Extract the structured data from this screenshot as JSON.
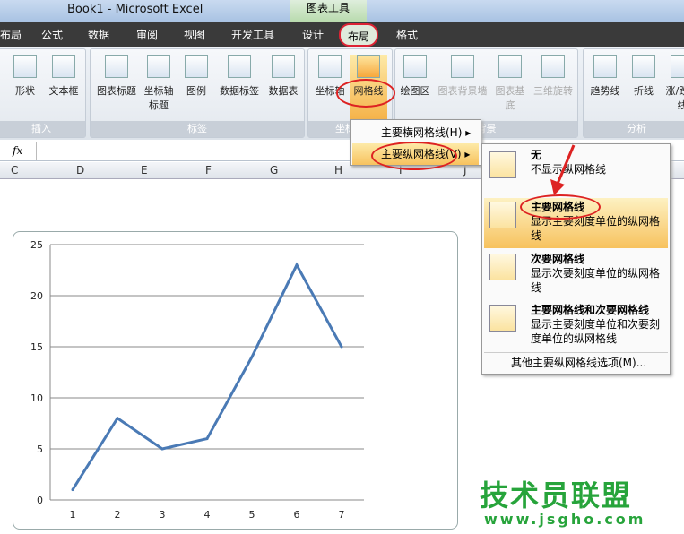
{
  "window": {
    "title": "Book1 - Microsoft Excel",
    "context_tab": "图表工具"
  },
  "tabs": [
    "布局",
    "公式",
    "数据",
    "审阅",
    "视图",
    "开发工具",
    "设计",
    "布局",
    "格式"
  ],
  "ribbon": {
    "insert": {
      "label": "插入",
      "buttons": [
        "形状",
        "文本框"
      ]
    },
    "labels": {
      "label": "标签",
      "buttons": [
        "图表标题",
        "坐标轴标题",
        "图例",
        "数据标签",
        "数据表"
      ]
    },
    "axes": {
      "label": "坐标轴",
      "buttons": [
        "坐标轴",
        "网格线"
      ]
    },
    "background": {
      "label": "背景",
      "buttons": [
        "绘图区",
        "图表背景墙",
        "图表基底",
        "三维旋转"
      ]
    },
    "analysis": {
      "label": "分析",
      "buttons": [
        "趋势线",
        "折线",
        "涨/跌柱线"
      ]
    }
  },
  "formula_bar": {
    "fx": "fx",
    "value": ""
  },
  "columns": [
    "C",
    "D",
    "E",
    "F",
    "G",
    "H",
    "I",
    "J"
  ],
  "gridlines_menu": {
    "items": [
      "主要横网格线(H)",
      "主要纵网格线(V)"
    ]
  },
  "vertical_submenu": {
    "items": [
      {
        "title": "无",
        "desc": "不显示纵网格线"
      },
      {
        "title": "主要网格线",
        "desc": "显示主要刻度单位的纵网格线"
      },
      {
        "title": "次要网格线",
        "desc": "显示次要刻度单位的纵网格线"
      },
      {
        "title": "主要网格线和次要网格线",
        "desc": "显示主要刻度单位和次要刻度单位的纵网格线"
      }
    ],
    "more": "其他主要纵网格线选项(M)..."
  },
  "chart_data": {
    "type": "line",
    "categories": [
      1,
      2,
      3,
      4,
      5,
      6,
      7
    ],
    "values": [
      1,
      8,
      5,
      6,
      14,
      23,
      15
    ],
    "ylim": [
      0,
      25
    ],
    "yticks": [
      0,
      5,
      10,
      15,
      20,
      25
    ],
    "grid": "horizontal major",
    "line_color": "#4a7ab5"
  },
  "watermark": {
    "text": "技术员联盟",
    "url": "www.jsgho.com"
  }
}
